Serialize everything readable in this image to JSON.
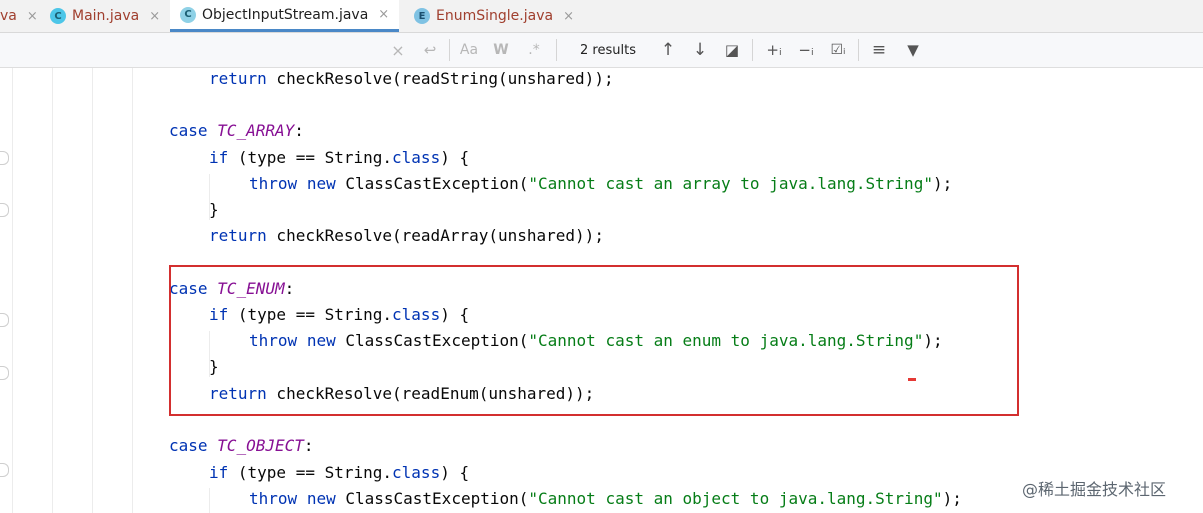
{
  "tabs": [
    {
      "label": "va",
      "icon": "",
      "close": "×"
    },
    {
      "label": "Main.java",
      "icon": "C",
      "close": "×"
    },
    {
      "label": "ObjectInputStream.java",
      "icon": "C",
      "close": "×"
    },
    {
      "label": "EnumSingle.java",
      "icon": "E",
      "close": "×"
    }
  ],
  "find": {
    "clear_glyph": "×",
    "undo_glyph": "↩",
    "match_case": "Aa",
    "words": "W",
    "regex": ".*",
    "results": "2 results",
    "prev_glyph": "↑",
    "next_glyph": "↓",
    "open_glyph": "◪",
    "add_occ": "+ᵢ",
    "remove_occ": "−ᵢ",
    "select_all": "☑ᵢ",
    "filter_lines": "≡",
    "filter": "▼"
  },
  "code": {
    "l1": {
      "kw": "return",
      "rest": " checkResolve(readString(unshared));"
    },
    "l2": {
      "kw": "case",
      "const": "TC_ARRAY",
      "rest": ":"
    },
    "l3": {
      "kw": "if",
      "pre": " (type == String.",
      "kw2": "class",
      "rest": ") {"
    },
    "l4": {
      "kw": "throw",
      "kw2": "new",
      "pre": " ClassCastException(",
      "str": "\"Cannot cast an array to java.lang.String\"",
      "rest": ");"
    },
    "l5": {
      "text": "}"
    },
    "l6": {
      "kw": "return",
      "rest": " checkResolve(readArray(unshared));"
    },
    "l7": {
      "kw": "case",
      "const": "TC_ENUM",
      "rest": ":"
    },
    "l8": {
      "kw": "if",
      "pre": " (type == String.",
      "kw2": "class",
      "rest": ") {"
    },
    "l9": {
      "kw": "throw",
      "kw2": "new",
      "pre": " ClassCastException(",
      "str": "\"Cannot cast an enum to java.lang.String\"",
      "rest": ");"
    },
    "l10": {
      "text": "}"
    },
    "l11": {
      "kw": "return",
      "rest": " checkResolve(readEnum(unshared));"
    },
    "l12": {
      "kw": "case",
      "const": "TC_OBJECT",
      "rest": ":"
    },
    "l13": {
      "kw": "if",
      "pre": " (type == String.",
      "kw2": "class",
      "rest": ") {"
    },
    "l14": {
      "kw": "throw",
      "kw2": "new",
      "pre": " ClassCastException(",
      "str": "\"Cannot cast an object to java.lang.String\"",
      "rest": ");"
    }
  },
  "watermark": "@稀土掘金技术社区"
}
